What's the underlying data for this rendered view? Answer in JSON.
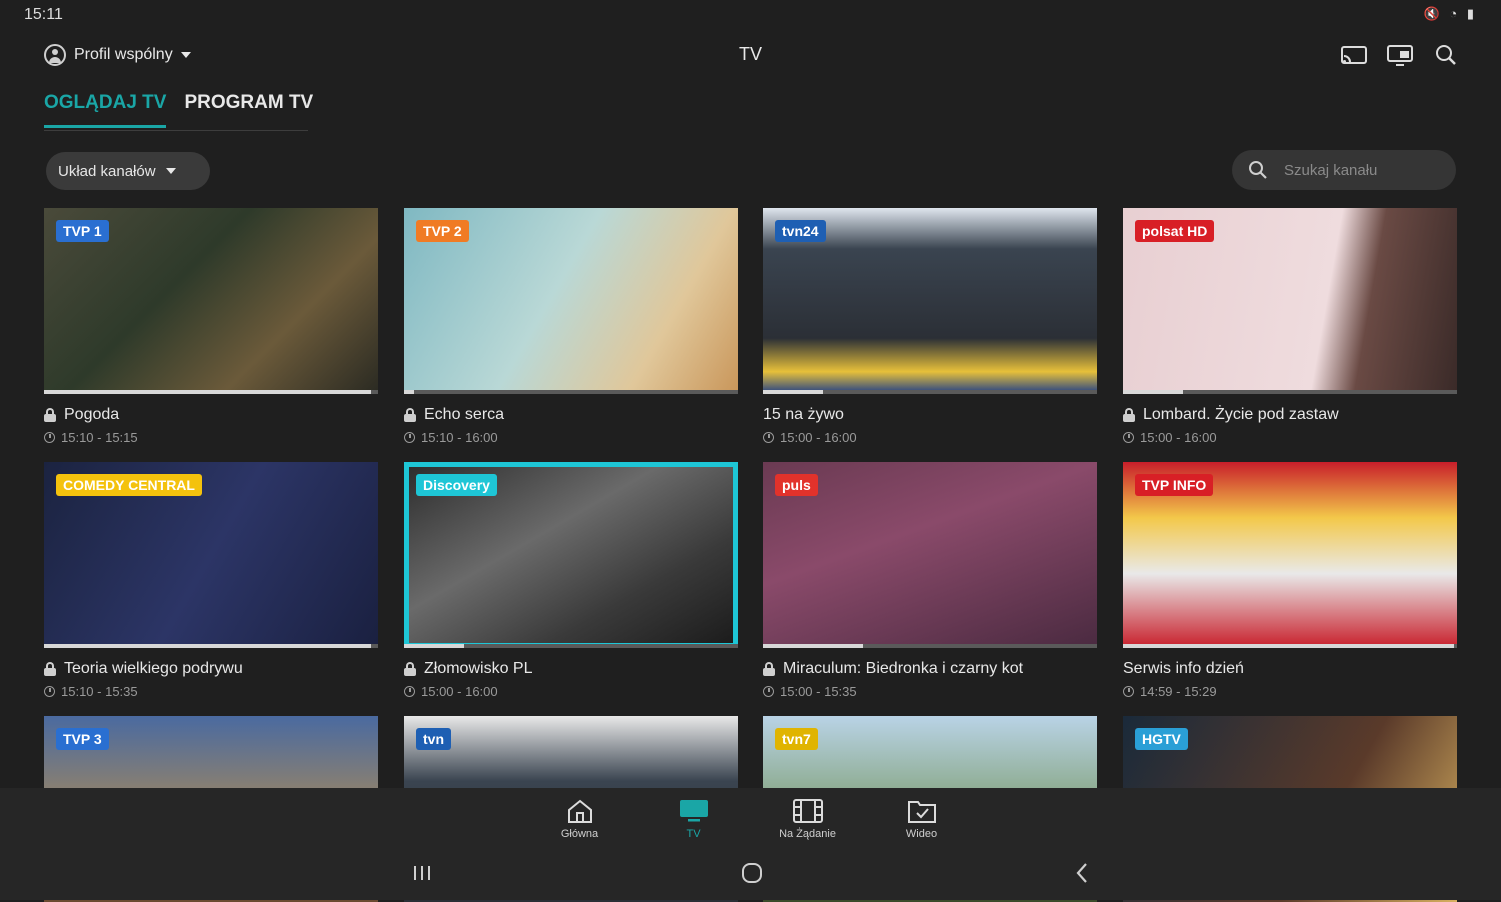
{
  "status": {
    "time": "15:11",
    "icons": [
      "mute-icon",
      "wifi-icon",
      "battery-icon"
    ]
  },
  "header": {
    "profile_label": "Profil wspólny",
    "title": "TV",
    "icons": [
      "cast-icon",
      "screen-mirror-icon",
      "search-icon"
    ]
  },
  "tabs": [
    {
      "label": "OGLĄDAJ TV",
      "active": true
    },
    {
      "label": "PROGRAM TV",
      "active": false
    }
  ],
  "filters": {
    "layout_label": "Układ kanałów",
    "search_placeholder": "Szukaj kanału"
  },
  "channels": [
    {
      "channel": "TVP 1",
      "title": "Pogoda",
      "time": "15:10 - 15:15",
      "locked": true,
      "progress": 0.98,
      "accent": "#2a6fd1"
    },
    {
      "channel": "TVP 2",
      "title": "Echo serca",
      "time": "15:10 - 16:00",
      "locked": true,
      "progress": 0.03,
      "accent": "#f07b24"
    },
    {
      "channel": "tvn24",
      "title": "15 na żywo",
      "time": "15:00 - 16:00",
      "locked": false,
      "progress": 0.18,
      "accent": "#1e5fb3"
    },
    {
      "channel": "polsat HD",
      "title": "Lombard. Życie pod zastaw",
      "time": "15:00 - 16:00",
      "locked": true,
      "progress": 0.18,
      "accent": "#d81f26"
    },
    {
      "channel": "COMEDY CENTRAL",
      "title": "Teoria wielkiego podrywu",
      "time": "15:10 - 15:35",
      "locked": true,
      "progress": 0.98,
      "accent": "#f4c20d"
    },
    {
      "channel": "Discovery",
      "title": "Złomowisko PL",
      "time": "15:00 - 16:00",
      "locked": true,
      "progress": 0.18,
      "accent": "#1ec6d6"
    },
    {
      "channel": "puls",
      "title": "Miraculum: Biedronka i czarny kot",
      "time": "15:00 - 15:35",
      "locked": true,
      "progress": 0.3,
      "accent": "#e2322b"
    },
    {
      "channel": "TVP INFO",
      "title": "Serwis info dzień",
      "time": "14:59 - 15:29",
      "locked": false,
      "progress": 0.99,
      "accent": "#d81f26"
    },
    {
      "channel": "TVP 3",
      "title": "",
      "time": "",
      "locked": false,
      "progress": 0,
      "accent": "#2a6fd1"
    },
    {
      "channel": "tvn",
      "title": "",
      "time": "",
      "locked": false,
      "progress": 0,
      "accent": "#1e5fb3"
    },
    {
      "channel": "tvn7",
      "title": "",
      "time": "",
      "locked": false,
      "progress": 0,
      "accent": "#e0b400"
    },
    {
      "channel": "HGTV",
      "title": "",
      "time": "",
      "locked": false,
      "progress": 0,
      "accent": "#2a9fd6"
    }
  ],
  "bottom_nav": [
    {
      "label": "Główna",
      "icon": "home-icon",
      "active": false
    },
    {
      "label": "TV",
      "icon": "tv-icon",
      "active": true
    },
    {
      "label": "Na Żądanie",
      "icon": "film-icon",
      "active": false
    },
    {
      "label": "Wideo",
      "icon": "video-folder-icon",
      "active": false
    }
  ],
  "system_nav": [
    "recent-apps-icon",
    "home-circle-icon",
    "back-icon"
  ]
}
